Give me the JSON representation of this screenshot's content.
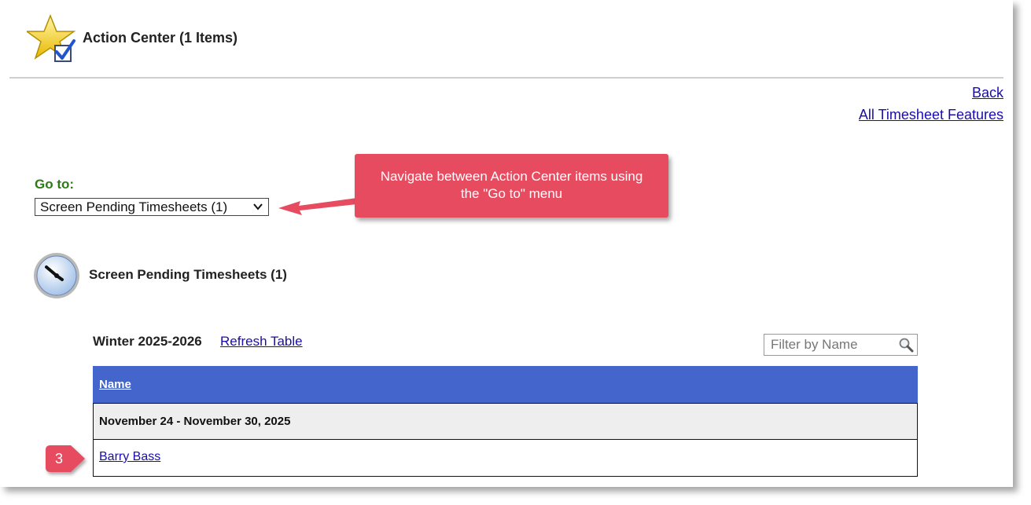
{
  "header": {
    "title": "Action Center (1 Items)"
  },
  "links": {
    "back": "Back",
    "all_features": "All Timesheet Features"
  },
  "goto": {
    "label": "Go to:",
    "selected": "Screen Pending Timesheets (1)"
  },
  "callout": {
    "line1": "Navigate between Action Center items using",
    "line2": "the \"Go to\" menu",
    "color": "#e74b60"
  },
  "section": {
    "title": "Screen Pending Timesheets (1)",
    "icon": "clock-icon"
  },
  "table_controls": {
    "period": "Winter 2025-2026",
    "refresh": "Refresh Table",
    "filter_placeholder": "Filter by Name"
  },
  "table": {
    "header": "Name",
    "header_color": "#4466cc",
    "groups": [
      {
        "label": "November 24 - November 30, 2025",
        "rows": [
          "Barry Bass"
        ]
      }
    ]
  },
  "step_badge": {
    "number": "3",
    "color": "#e74b60"
  }
}
